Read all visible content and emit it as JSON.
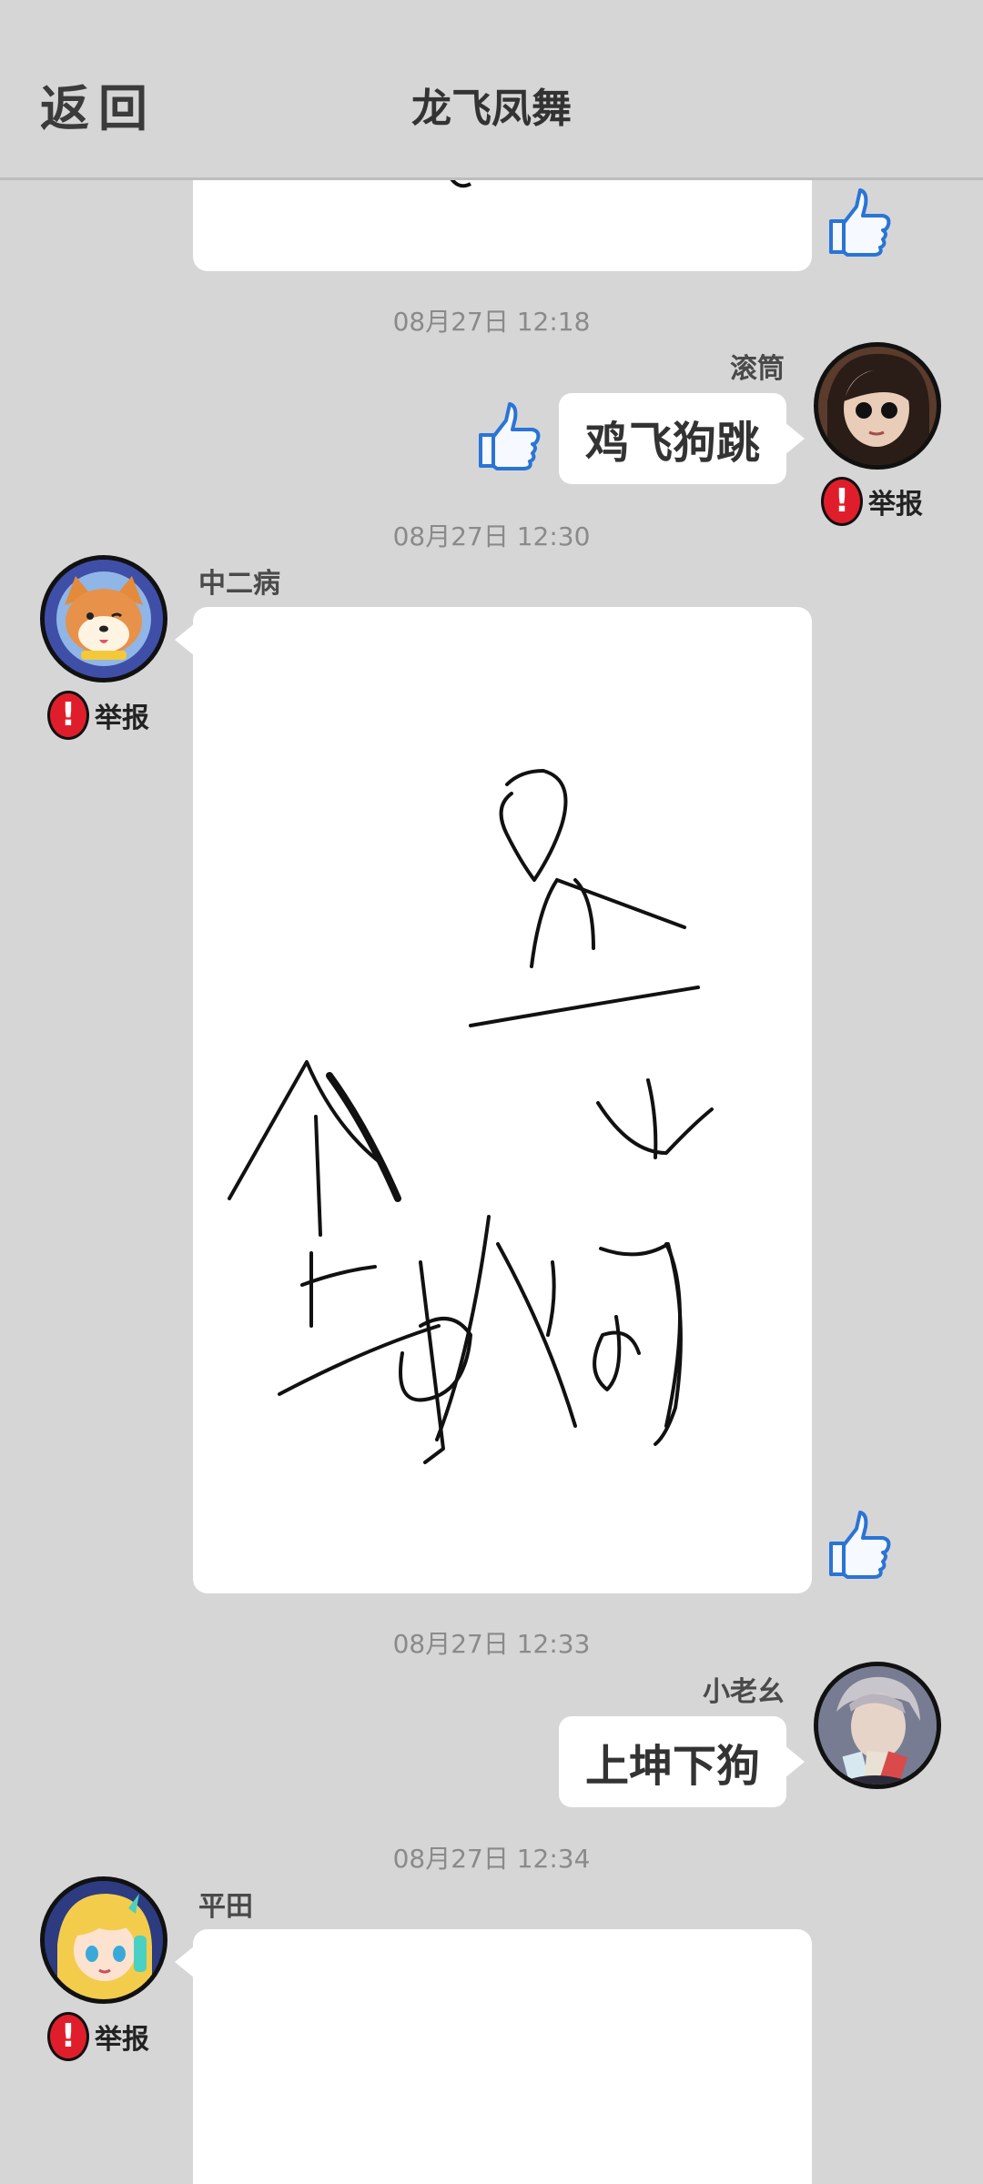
{
  "header": {
    "back_label": "返回",
    "title": "龙飞凤舞"
  },
  "messages": [
    {
      "timestamp": "08月27日  12:18",
      "sender": "滚筒",
      "text": "鸡飞狗跳",
      "report_label": "举报",
      "avatar": "dark-haired-girl-avatar"
    },
    {
      "timestamp": "08月27日  12:30",
      "sender": "中二病",
      "type": "drawing",
      "drawing": "handwritten-characters",
      "report_label": "举报",
      "avatar": "shiba-dog-avatar"
    },
    {
      "timestamp": "08月27日  12:33",
      "sender": "小老幺",
      "text": "上坤下狗",
      "avatar": "anime-card-player-avatar"
    },
    {
      "timestamp": "08月27日  12:34",
      "sender": "平田",
      "type": "drawing",
      "report_label": "举报",
      "avatar": "blonde-anime-girl-avatar"
    }
  ],
  "colors": {
    "background": "#d6d6d6",
    "bubble": "#ffffff",
    "report_red": "#e01e2b",
    "like_blue": "#2a74d6"
  },
  "icons": {
    "like": "thumbs-up-icon",
    "report": "exclamation-icon"
  }
}
